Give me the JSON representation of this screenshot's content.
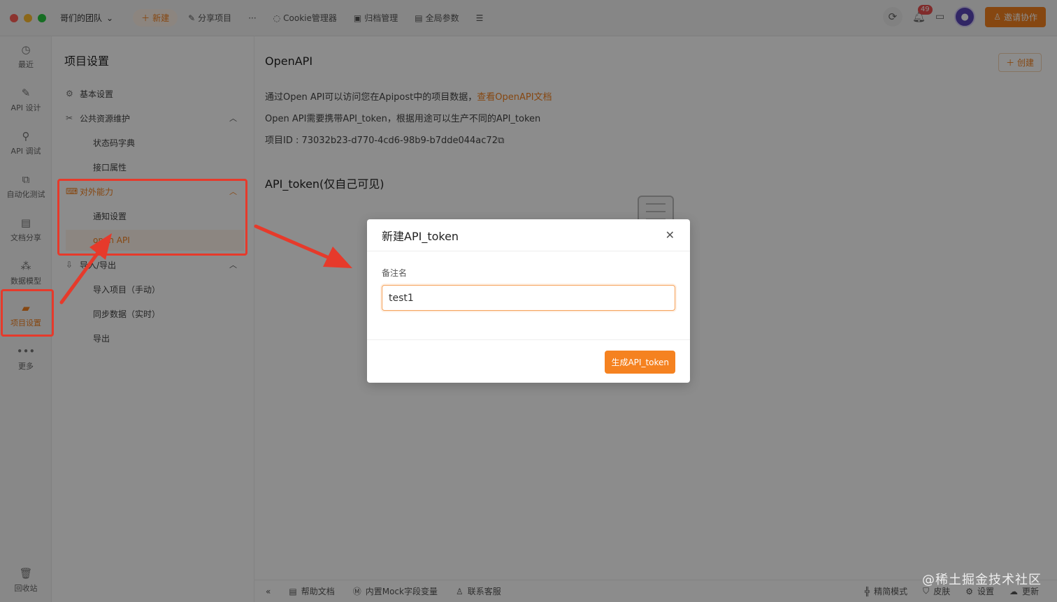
{
  "titlebar": {
    "team": "哥们的团队",
    "toolbar": {
      "new": "新建",
      "share": "分享项目",
      "more": "···",
      "cookie": "Cookie管理器",
      "archive": "归档管理",
      "globals": "全局参数"
    },
    "notifications_count": "49",
    "invite": "邀请协作"
  },
  "rail": {
    "items": [
      {
        "label": "最近",
        "icon": "clock-icon"
      },
      {
        "label": "API 设计",
        "icon": "edit-icon"
      },
      {
        "label": "API 调试",
        "icon": "debug-icon"
      },
      {
        "label": "自动化测试",
        "icon": "flow-icon"
      },
      {
        "label": "文档分享",
        "icon": "doc-icon"
      },
      {
        "label": "数据模型",
        "icon": "model-icon"
      },
      {
        "label": "项目设置",
        "icon": "folder-settings-icon"
      },
      {
        "label": "更多",
        "icon": "more-icon"
      }
    ],
    "trash": "回收站"
  },
  "sidebar": {
    "title": "项目设置",
    "basic": "基本设置",
    "public_resources": "公共资源维护",
    "status_codes": "状态码字典",
    "api_attrs": "接口属性",
    "external": "对外能力",
    "notify": "通知设置",
    "open_api": "open API",
    "import_export": "导入/导出",
    "import_manual": "导入项目（手动）",
    "sync_realtime": "同步数据（实时）",
    "export": "导出"
  },
  "main": {
    "title": "OpenAPI",
    "create": "创建",
    "desc1_text": "通过Open API可以访问您在Apipost中的项目数据，",
    "desc1_link": "查看OpenAPI文档",
    "desc2": "Open API需要携带API_token，根据用途可以生产不同的API_token",
    "project_id": "项目ID : 73032b23-d770-4cd6-98b9-b7dde044ac72",
    "token_section": "API_token(仅自己可见)"
  },
  "bottombar": {
    "help": "帮助文档",
    "mock": "内置Mock字段变量",
    "support": "联系客服",
    "compact": "精简模式",
    "skin": "皮肤",
    "settings": "设置",
    "update": "更新"
  },
  "modal": {
    "title": "新建API_token",
    "label": "备注名",
    "value": "test1",
    "submit": "生成API_token"
  },
  "watermark": "@稀土掘金技术社区",
  "colors": {
    "accent": "#f58220",
    "annotation": "#e63a2b"
  }
}
